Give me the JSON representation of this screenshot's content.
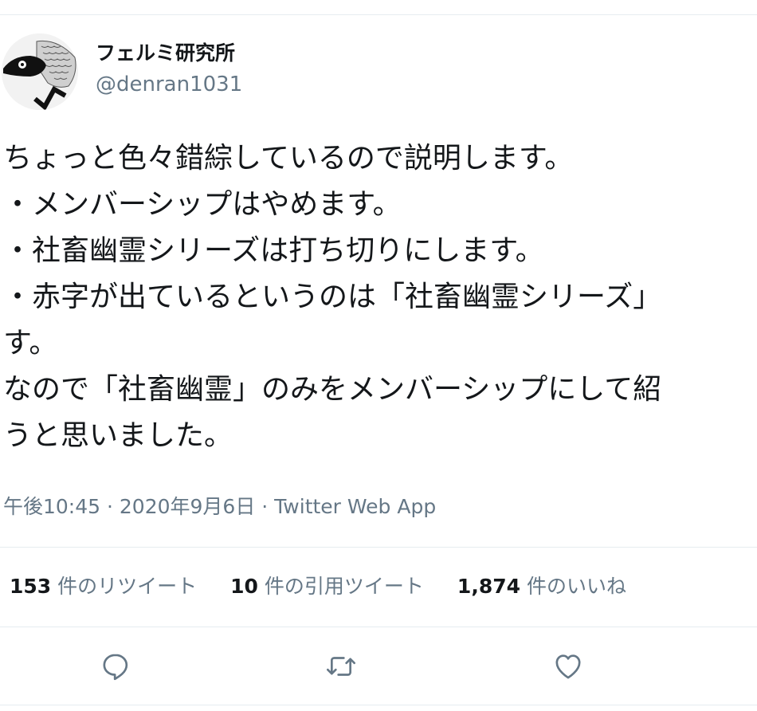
{
  "author": {
    "display_name": "フェルミ研究所",
    "handle": "@denran1031"
  },
  "tweet": {
    "lines": [
      "ちょっと色々錯綜しているので説明します。",
      "・メンバーシップはやめます。",
      "・社畜幽霊シリーズは打ち切りにします。",
      "・赤字が出ているというのは「社畜幽霊シリーズ」",
      "す。",
      "なので「社畜幽霊」のみをメンバーシップにして紹",
      "うと思いました。"
    ],
    "timestamp": "午後10:45 · 2020年9月6日",
    "separator": " · ",
    "source": "Twitter Web App"
  },
  "stats": [
    {
      "count": "153",
      "label": "件のリツイート"
    },
    {
      "count": "10",
      "label": "件の引用ツイート"
    },
    {
      "count": "1,874",
      "label": "件のいいね"
    }
  ],
  "actions": {
    "reply_icon": "reply-icon",
    "retweet_icon": "retweet-icon",
    "like_icon": "heart-icon",
    "icon_color": "#657786"
  },
  "colors": {
    "text": "#14171a",
    "secondary": "#657786",
    "divider": "#e6ecf0"
  }
}
